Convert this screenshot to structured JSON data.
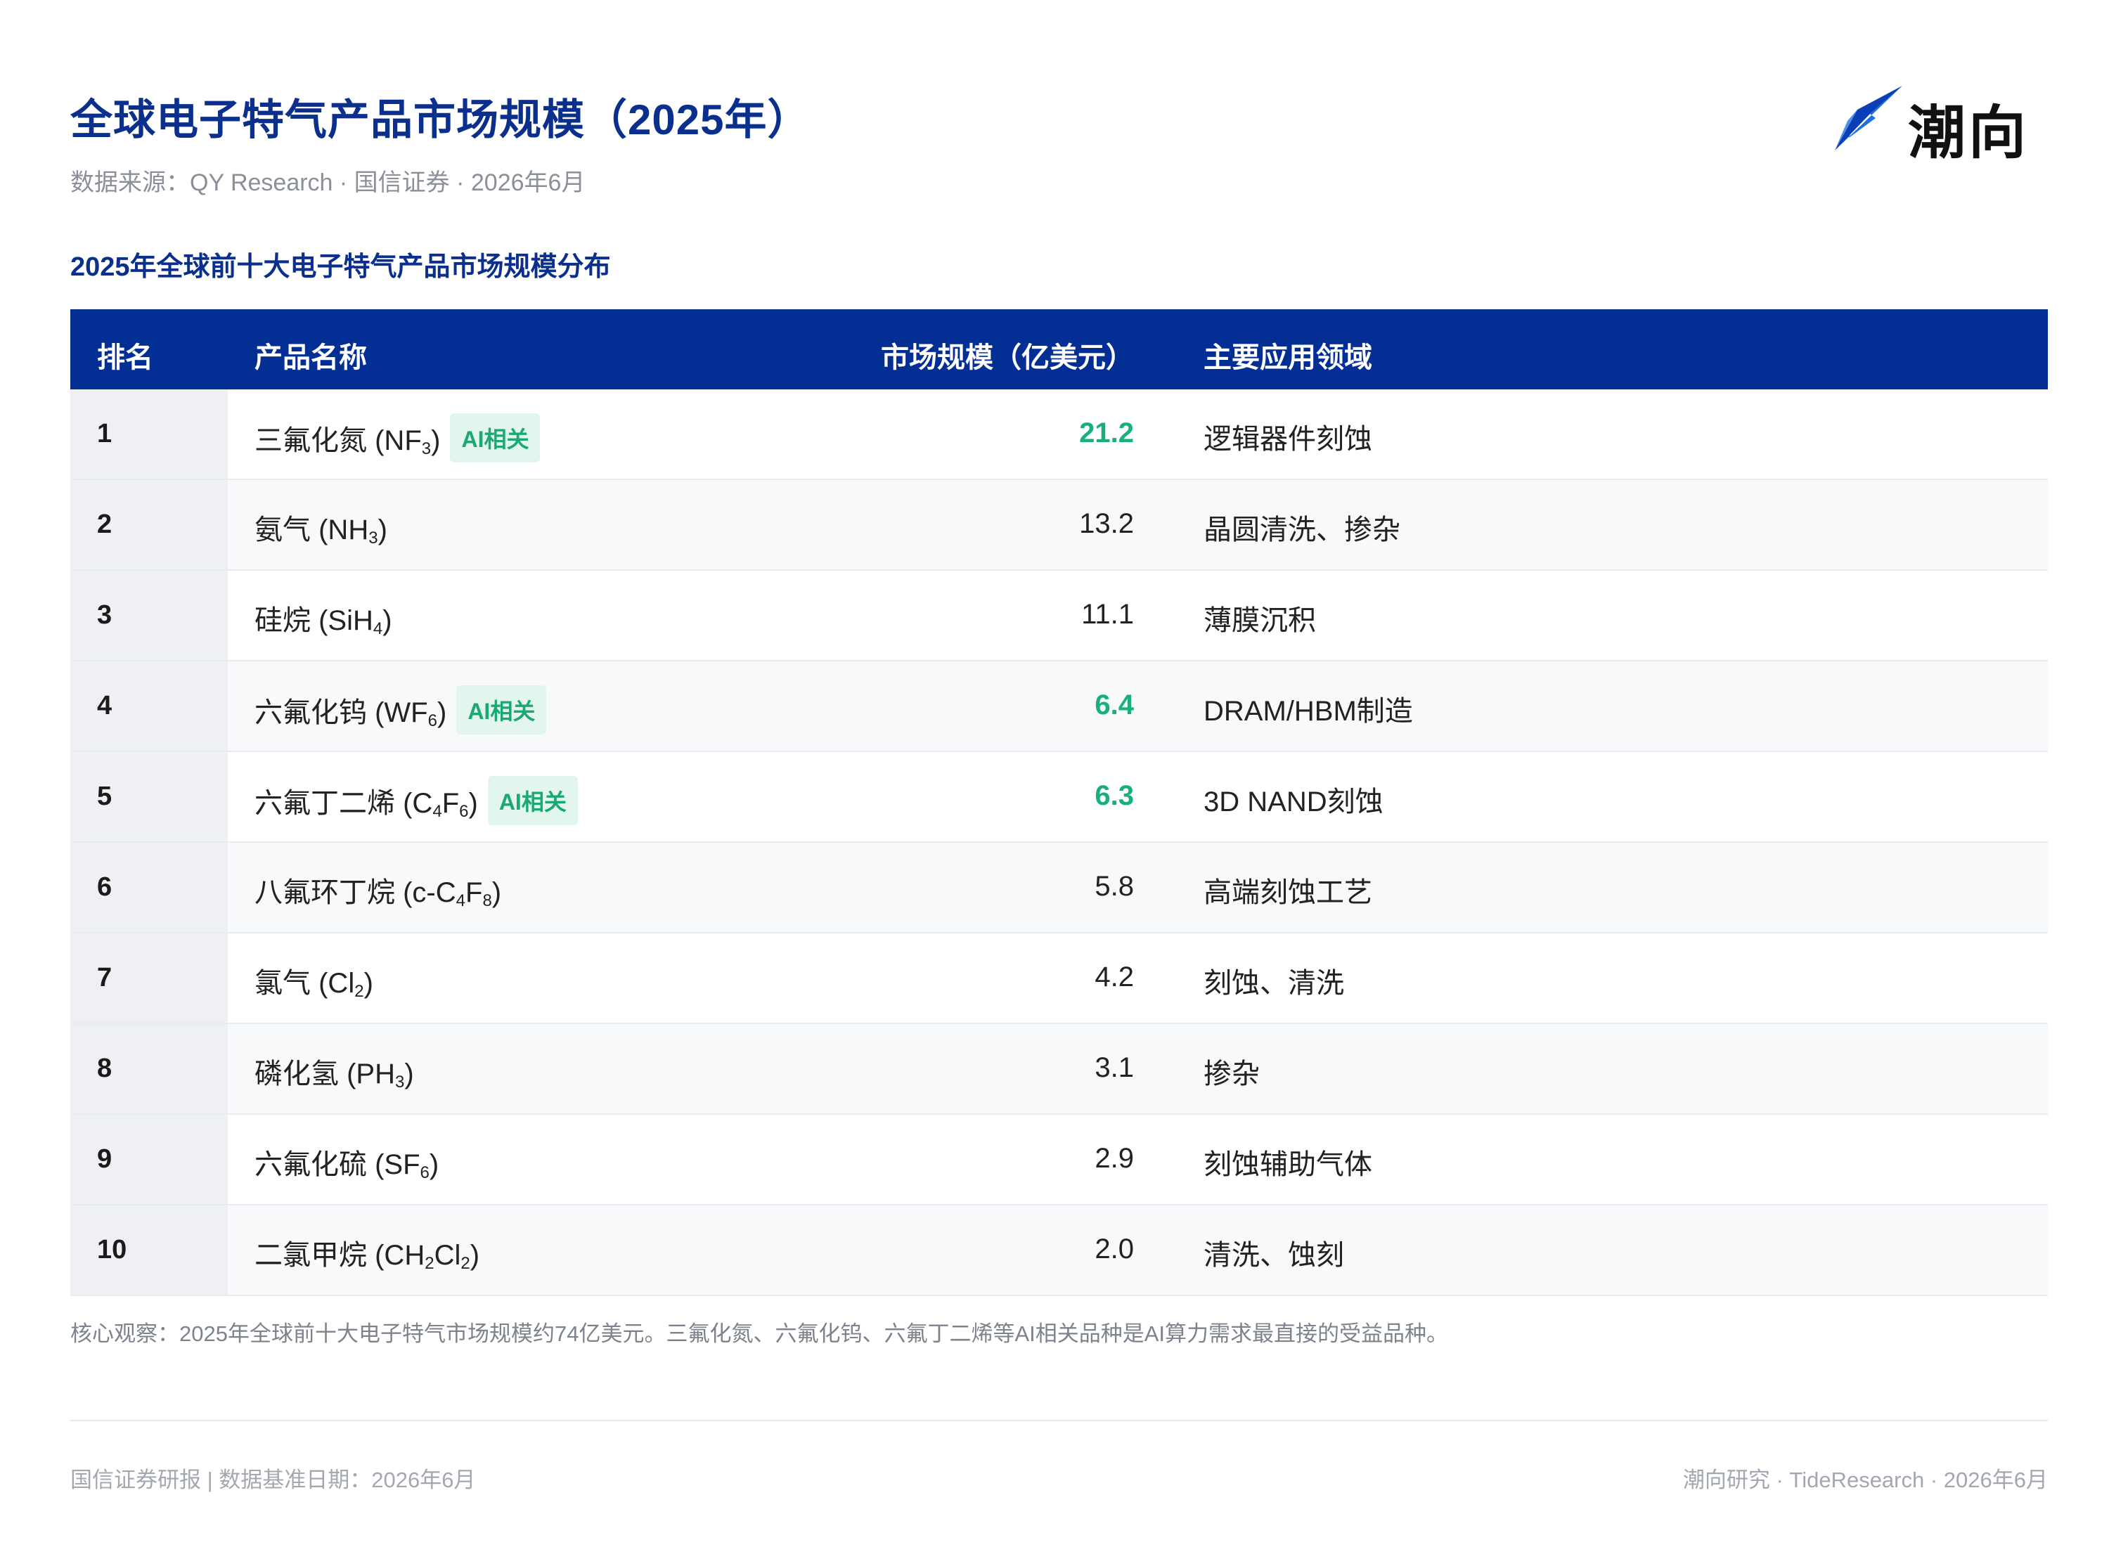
{
  "header": {
    "title": "全球电子特气产品市场规模（2025年）",
    "subtitle": "数据来源：QY Research · 国信证券 · 2026年6月",
    "logo_text": "潮向",
    "logo_icon": "blue-arrow-logo-icon"
  },
  "section_title": "2025年全球前十大电子特气产品市场规模分布",
  "table": {
    "columns": [
      "排名",
      "产品名称",
      "市场规模（亿美元）",
      "主要应用领域"
    ],
    "ai_tag_label": "AI相关",
    "rows": [
      {
        "rank": "1",
        "name": "三氟化氮 (NF",
        "sub1": "3",
        "mid": "",
        "sub2": "",
        "end": ")",
        "size": "21.2",
        "ai": true,
        "app": "逻辑器件刻蚀"
      },
      {
        "rank": "2",
        "name": "氨气 (NH",
        "sub1": "3",
        "mid": "",
        "sub2": "",
        "end": ")",
        "size": "13.2",
        "ai": false,
        "app": "晶圆清洗、掺杂"
      },
      {
        "rank": "3",
        "name": "硅烷 (SiH",
        "sub1": "4",
        "mid": "",
        "sub2": "",
        "end": ")",
        "size": "11.1",
        "ai": false,
        "app": "薄膜沉积"
      },
      {
        "rank": "4",
        "name": "六氟化钨 (WF",
        "sub1": "6",
        "mid": "",
        "sub2": "",
        "end": ")",
        "size": "6.4",
        "ai": true,
        "app": "DRAM/HBM制造"
      },
      {
        "rank": "5",
        "name": "六氟丁二烯 (C",
        "sub1": "4",
        "mid": "F",
        "sub2": "6",
        "end": ")",
        "size": "6.3",
        "ai": true,
        "app": "3D NAND刻蚀"
      },
      {
        "rank": "6",
        "name": "八氟环丁烷 (c-C",
        "sub1": "4",
        "mid": "F",
        "sub2": "8",
        "end": ")",
        "size": "5.8",
        "ai": false,
        "app": "高端刻蚀工艺"
      },
      {
        "rank": "7",
        "name": "氯气 (Cl",
        "sub1": "2",
        "mid": "",
        "sub2": "",
        "end": ")",
        "size": "4.2",
        "ai": false,
        "app": "刻蚀、清洗"
      },
      {
        "rank": "8",
        "name": "磷化氢 (PH",
        "sub1": "3",
        "mid": "",
        "sub2": "",
        "end": ")",
        "size": "3.1",
        "ai": false,
        "app": "掺杂"
      },
      {
        "rank": "9",
        "name": "六氟化硫 (SF",
        "sub1": "6",
        "mid": "",
        "sub2": "",
        "end": ")",
        "size": "2.9",
        "ai": false,
        "app": "刻蚀辅助气体"
      },
      {
        "rank": "10",
        "name": "二氯甲烷 (CH",
        "sub1": "2",
        "mid": "Cl",
        "sub2": "2",
        "end": ")",
        "size": "2.0",
        "ai": false,
        "app": "清洗、蚀刻"
      }
    ]
  },
  "note": "核心观察：2025年全球前十大电子特气市场规模约74亿美元。三氟化氮、六氟化钨、六氟丁二烯等AI相关品种是AI算力需求最直接的受益品种。",
  "footer": {
    "left": "国信证券研报 | 数据基准日期：2026年6月",
    "right": "潮向研究 · TideResearch · 2026年6月"
  },
  "colors": {
    "brand_blue": "#032f95",
    "title_blue": "#0a2f8c",
    "ai_green": "#18b07a",
    "ai_tag_bg": "#e3f6ee"
  }
}
